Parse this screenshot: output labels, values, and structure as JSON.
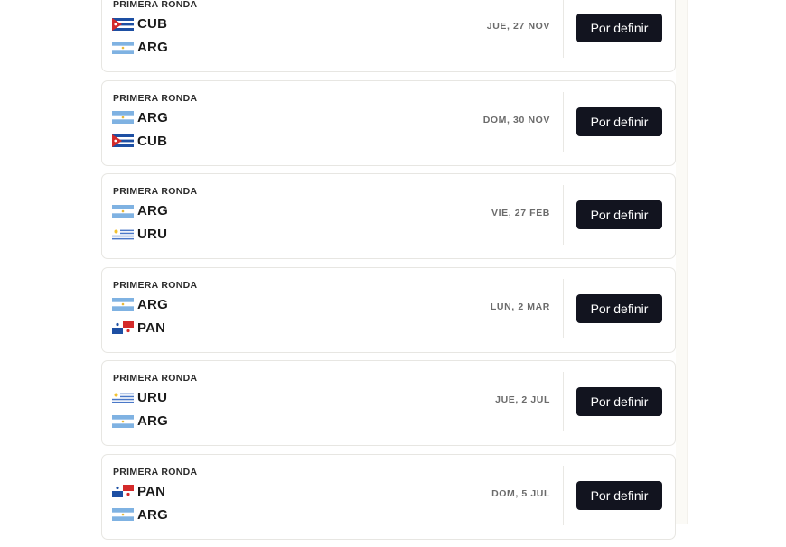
{
  "matches": [
    {
      "round": "PRIMERA RONDA",
      "team1": {
        "code": "CUB",
        "flag": "cuba-flag"
      },
      "team2": {
        "code": "ARG",
        "flag": "argentina-flag"
      },
      "date": "JUE, 27 NOV",
      "button": "Por definir"
    },
    {
      "round": "PRIMERA RONDA",
      "team1": {
        "code": "ARG",
        "flag": "argentina-flag"
      },
      "team2": {
        "code": "CUB",
        "flag": "cuba-flag"
      },
      "date": "DOM, 30 NOV",
      "button": "Por definir"
    },
    {
      "round": "PRIMERA RONDA",
      "team1": {
        "code": "ARG",
        "flag": "argentina-flag"
      },
      "team2": {
        "code": "URU",
        "flag": "uruguay-flag"
      },
      "date": "VIE, 27 FEB",
      "button": "Por definir"
    },
    {
      "round": "PRIMERA RONDA",
      "team1": {
        "code": "ARG",
        "flag": "argentina-flag"
      },
      "team2": {
        "code": "PAN",
        "flag": "panama-flag"
      },
      "date": "LUN, 2 MAR",
      "button": "Por definir"
    },
    {
      "round": "PRIMERA RONDA",
      "team1": {
        "code": "URU",
        "flag": "uruguay-flag"
      },
      "team2": {
        "code": "ARG",
        "flag": "argentina-flag"
      },
      "date": "JUE, 2 JUL",
      "button": "Por definir"
    },
    {
      "round": "PRIMERA RONDA",
      "team1": {
        "code": "PAN",
        "flag": "panama-flag"
      },
      "team2": {
        "code": "ARG",
        "flag": "argentina-flag"
      },
      "date": "DOM, 5 JUL",
      "button": "Por definir"
    }
  ],
  "colors": {
    "button_bg": "#12141f",
    "button_text": "#ffffff",
    "card_border": "#e7e6e2"
  }
}
